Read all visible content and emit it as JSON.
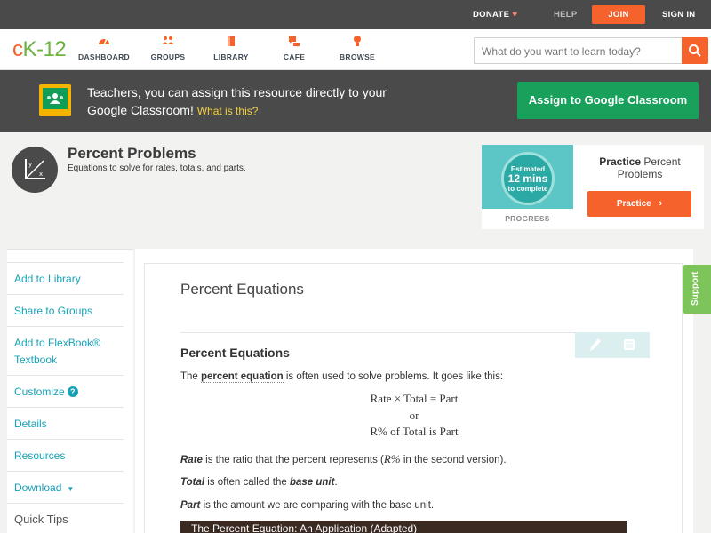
{
  "topbar": {
    "donate": "DONATE",
    "help": "HELP",
    "join": "JOIN",
    "signin": "SIGN IN"
  },
  "nav": {
    "logo": "CK-12",
    "items": [
      {
        "label": "DASHBOARD",
        "icon": "dashboard-icon"
      },
      {
        "label": "GROUPS",
        "icon": "groups-icon"
      },
      {
        "label": "LIBRARY",
        "icon": "library-icon"
      },
      {
        "label": "CAFE",
        "icon": "cafe-icon"
      },
      {
        "label": "BROWSE",
        "icon": "browse-icon"
      }
    ],
    "search_placeholder": "What do you want to learn today?"
  },
  "banner": {
    "text": "Teachers, you can assign this resource directly to your Google Classroom!",
    "what": "What is this?",
    "button": "Assign to Google Classroom"
  },
  "header": {
    "title": "Percent Problems",
    "subtitle": "Equations to solve for rates, totals, and parts."
  },
  "practice": {
    "est_line1": "Estimated",
    "est_mins": "12 mins",
    "est_line3": "to complete",
    "progress": "PROGRESS",
    "title_bold": "Practice",
    "title_rest": "Percent Problems",
    "button": "Practice"
  },
  "sidebar": {
    "items": [
      {
        "label": "Add to Library"
      },
      {
        "label": "Share to Groups"
      },
      {
        "label": "Add to FlexBook® Textbook"
      },
      {
        "label": "Customize"
      },
      {
        "label": "Details"
      },
      {
        "label": "Resources"
      },
      {
        "label": "Download"
      }
    ],
    "tips": "Quick Tips"
  },
  "content": {
    "title": "Percent Equations",
    "section": "Percent Equations",
    "p1_a": "The ",
    "p1_kw": "percent equation",
    "p1_b": " is often used to solve problems. It goes like this:",
    "m1": "Rate × Total = Part",
    "m2": "or",
    "m3": "R% of Total is Part",
    "p2_kw": "Rate",
    "p2_b": " is the ratio that the percent represents (",
    "p2_math": "R%",
    "p2_c": " in the second version).",
    "p3_kw": "Total",
    "p3_b": " is often called the ",
    "p3_kw2": "base unit",
    "p3_c": ".",
    "p4_kw": "Part",
    "p4_b": " is the amount we are comparing with the base unit.",
    "video_title": "The Percent Equation: An Application (Adapted)"
  },
  "support": "Support",
  "colors": {
    "accent": "#f5622c",
    "green": "#19a05b",
    "link": "#17a2b8",
    "dark": "#4a4a4a"
  }
}
